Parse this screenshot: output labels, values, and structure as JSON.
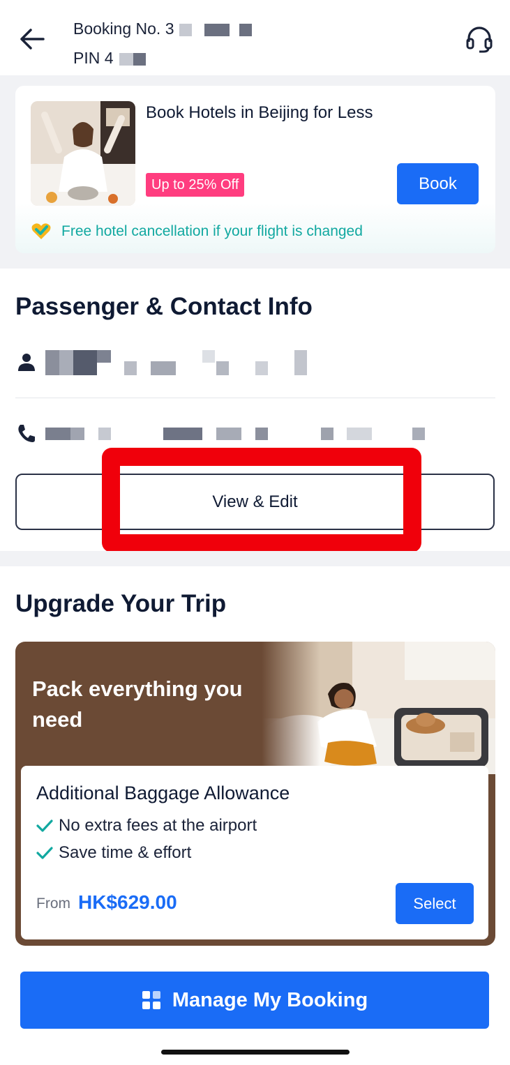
{
  "header": {
    "booking_label": "Booking No. 3",
    "pin_label": "PIN 4"
  },
  "hotel_promo": {
    "title": "Book Hotels in Beijing for Less",
    "tag": "Up to 25% Off",
    "book_label": "Book",
    "cancel_note": "Free hotel cancellation if your flight is changed"
  },
  "passenger": {
    "section_title": "Passenger & Contact Info",
    "view_edit_label": "View & Edit"
  },
  "upgrade": {
    "section_title": "Upgrade Your Trip",
    "headline": "Pack everything you need",
    "product_title": "Additional Baggage Allowance",
    "features": [
      "No extra fees at the airport",
      "Save time & effort"
    ],
    "price_prefix": "From",
    "price": "HK$629.00",
    "select_label": "Select"
  },
  "footer": {
    "manage_label": "Manage My Booking"
  },
  "colors": {
    "primary": "#1a6cf6",
    "promo_pink": "#ff3d7f",
    "teal": "#11a8a0",
    "highlight_red": "#f0000b",
    "upgrade_brown": "#6b4a35"
  }
}
